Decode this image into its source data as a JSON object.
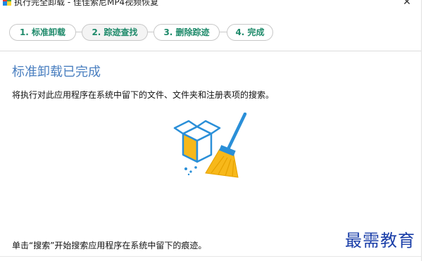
{
  "window": {
    "title": "执行完全卸载 - 佳佳索尼MP4视频恢复",
    "close_glyph": "✕"
  },
  "steps": [
    {
      "label": "1. 标准卸载",
      "state": "done"
    },
    {
      "label": "2. 踪迹查找",
      "state": "current"
    },
    {
      "label": "3. 删除踪迹",
      "state": "pending"
    },
    {
      "label": "4. 完成",
      "state": "pending"
    }
  ],
  "content": {
    "heading": "标准卸载已完成",
    "description": "将执行对此应用程序在系统中留下的文件、文件夹和注册表项的搜索。",
    "illustration_icon": "box-and-broom-icon",
    "hint": "单击“搜索”开始搜索应用程序在系统中留下的痕迹。"
  },
  "watermark": {
    "text": "最需教育"
  },
  "colors": {
    "accent_heading": "#4a7fc0",
    "step_text": "#1e8a6a",
    "broom_yellow": "#f7b81a",
    "broom_blue": "#2a8fd8"
  }
}
